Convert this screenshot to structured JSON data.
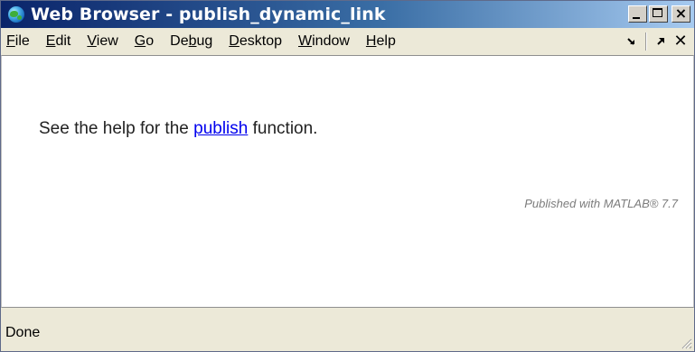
{
  "window": {
    "title": "Web Browser - publish_dynamic_link"
  },
  "menu": {
    "items": [
      {
        "label": "File",
        "mnemonic": "F",
        "rest": "ile"
      },
      {
        "label": "Edit",
        "mnemonic": "E",
        "rest": "dit"
      },
      {
        "label": "View",
        "mnemonic": "V",
        "rest": "iew"
      },
      {
        "label": "Go",
        "mnemonic": "G",
        "rest": "o"
      },
      {
        "label": "Debug",
        "pre": "De",
        "mnemonic": "b",
        "rest": "ug"
      },
      {
        "label": "Desktop",
        "mnemonic": "D",
        "rest": "esktop"
      },
      {
        "label": "Window",
        "mnemonic": "W",
        "rest": "indow"
      },
      {
        "label": "Help",
        "mnemonic": "H",
        "rest": "elp"
      }
    ],
    "right_icons": [
      "dock-icon",
      "undock-icon",
      "close-icon"
    ]
  },
  "content": {
    "text_before": "See the help for the ",
    "link_text": "publish",
    "text_after": " function.",
    "footer_note": "Published with MATLAB® 7.7"
  },
  "status": {
    "text": "Done"
  },
  "colors": {
    "title_start": "#0a246a",
    "title_end": "#a6caf0",
    "link": "#0000ee",
    "chrome": "#ece9d8"
  }
}
